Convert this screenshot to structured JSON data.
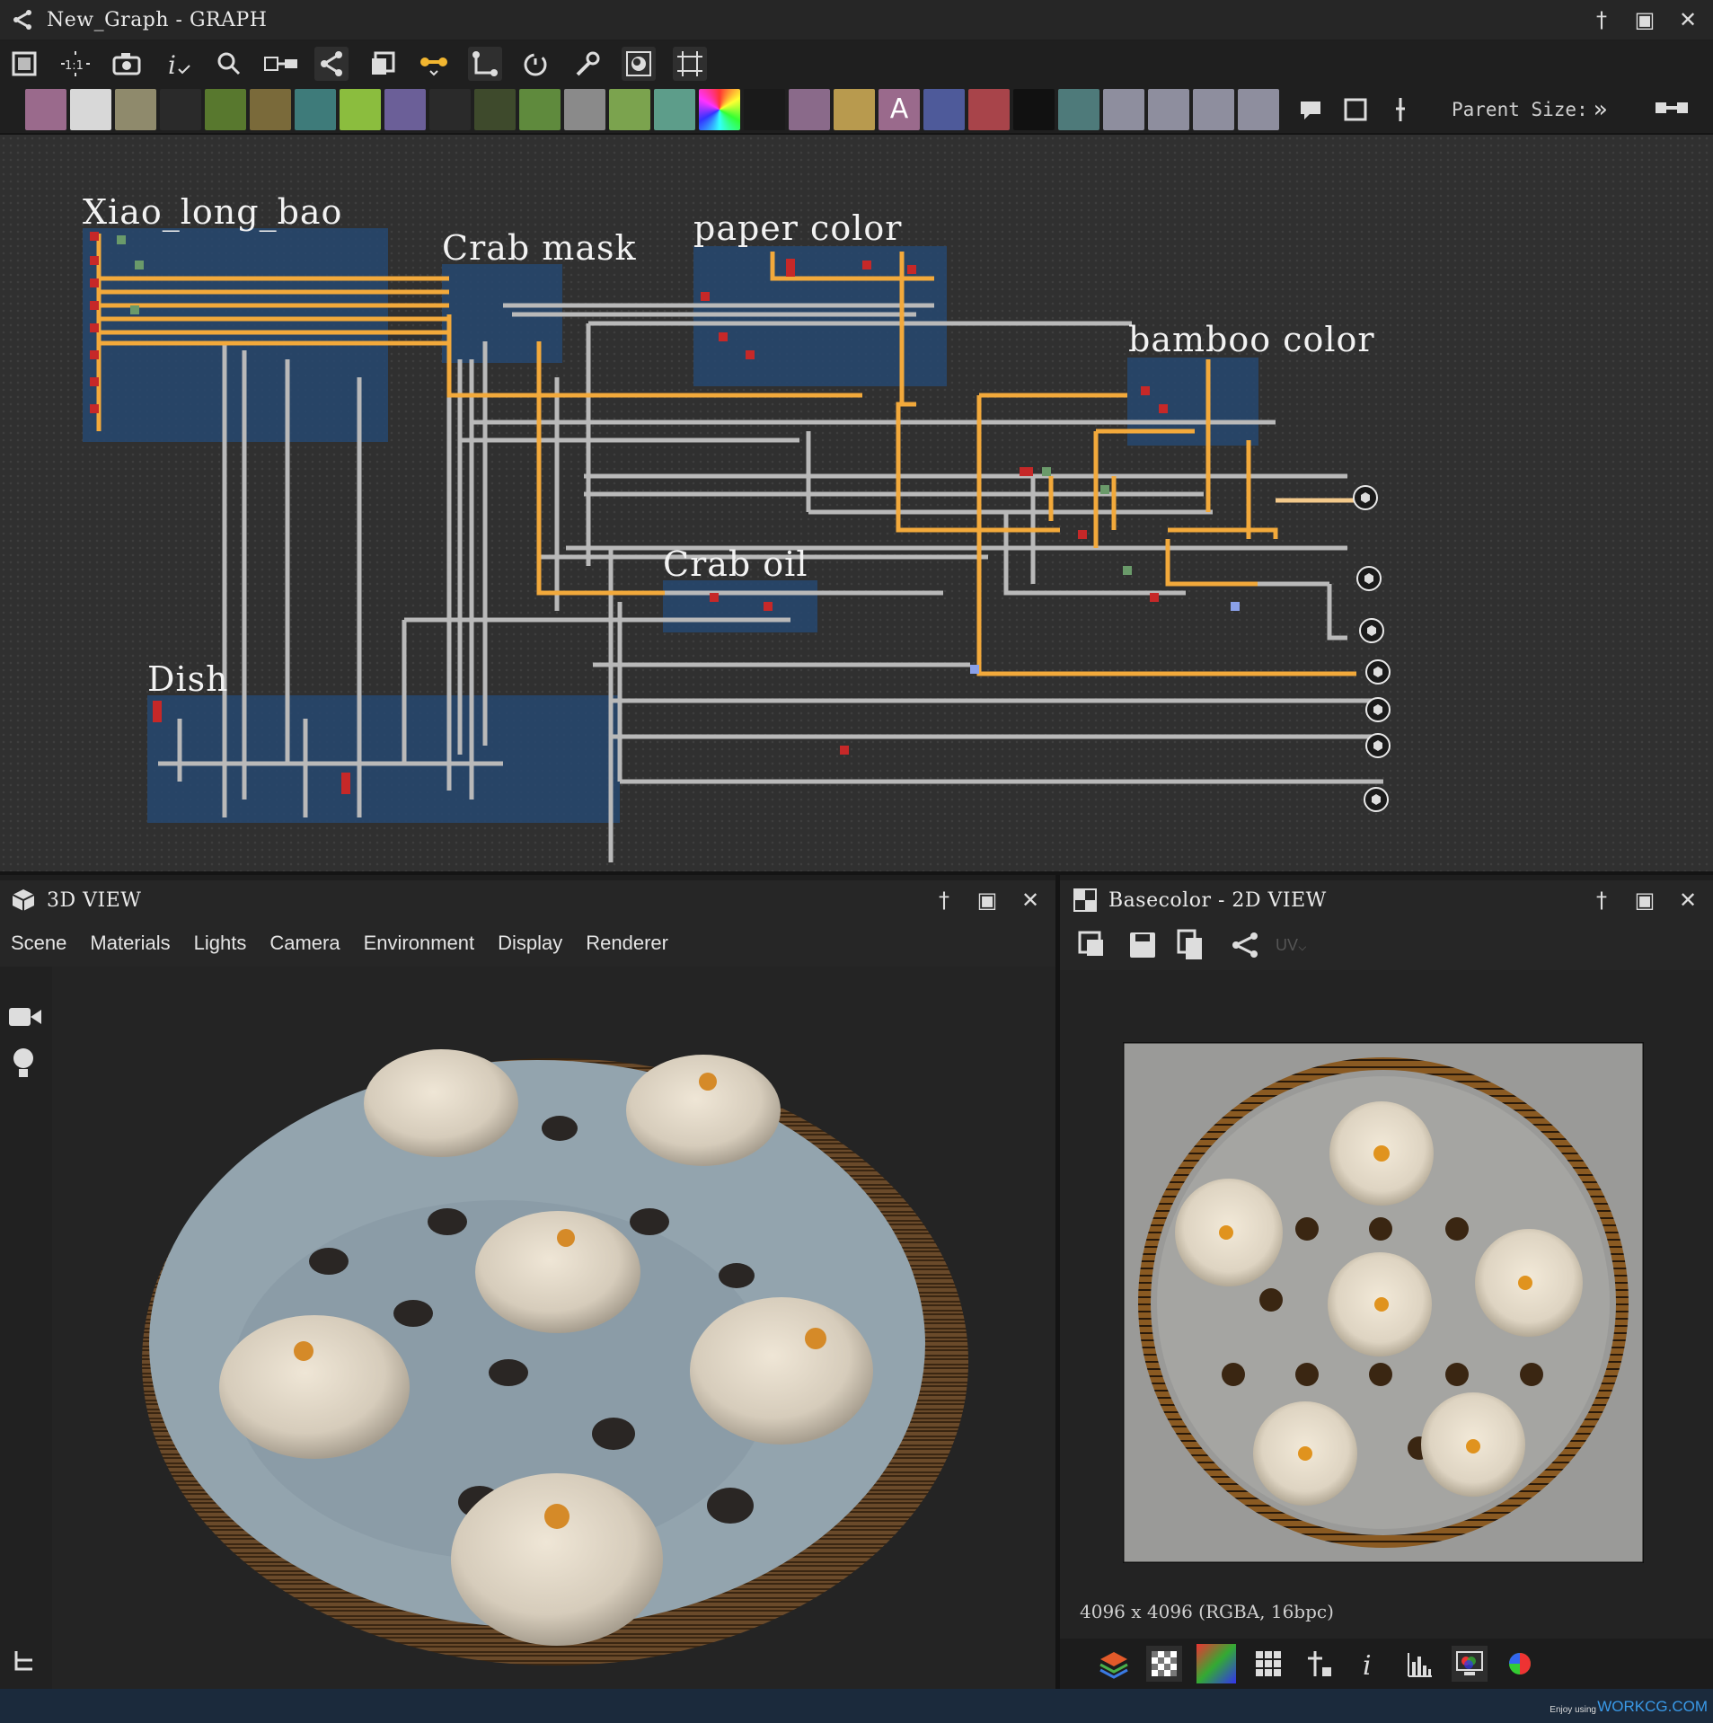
{
  "graph_window": {
    "title": "New_Graph - GRAPH"
  },
  "parent_size": {
    "label": "Parent Size:",
    "chevron": "»"
  },
  "frames": {
    "xiao": "Xiao_long_bao",
    "crab_mask": "Crab mask",
    "paper_color": "paper color",
    "bamboo_color": "bamboo color",
    "crab_oil": "Crab oil",
    "dish": "Dish"
  },
  "view3d": {
    "title": "3D VIEW",
    "menu": [
      "Scene",
      "Materials",
      "Lights",
      "Camera",
      "Environment",
      "Display",
      "Renderer"
    ]
  },
  "view2d": {
    "title": "Basecolor - 2D VIEW",
    "uv_label": "UV",
    "resolution": "4096 x 4096 (RGBA, 16bpc)"
  },
  "watermark": {
    "small": "Enjoy using",
    "brand": "WORKCG.COM"
  },
  "colors": {
    "accent_orange": "#f2a93b",
    "wire_gray": "#b9b9b9",
    "frame_blue": "#27476b",
    "bg": "#303030"
  },
  "icons": {
    "toolbar_main": [
      "fit-frame-icon",
      "zoom-1to1-icon",
      "camera-icon",
      "info-icon",
      "search-icon",
      "align-icon",
      "graph-share-icon",
      "layers-icon",
      "link-orange-icon",
      "connect-icon",
      "timer-icon",
      "wrench-icon",
      "snapshot-icon",
      "grid-crop-icon"
    ],
    "node_palette": [
      "bitmap-icon",
      "uniform-color-icon",
      "blend-icon",
      "blur-icon",
      "shuffle-icon",
      "curve-icon",
      "normal-icon",
      "warp-icon",
      "gradient-map-icon",
      "shape-icon",
      "tile-icon",
      "transform-icon",
      "pixel-processor-icon",
      "value-icon",
      "levels-icon",
      "histogram-icon",
      "hsl-icon",
      "noise-icon",
      "splatter-icon",
      "mirror-icon",
      "text-icon",
      "crop-icon",
      "fill-icon",
      "fxmap-icon",
      "svg-icon",
      "bitmap-input-icon",
      "gradient-input-icon",
      "function-input-icon",
      "output-icon",
      "comment-icon",
      "frame-icon",
      "pin-icon"
    ]
  }
}
